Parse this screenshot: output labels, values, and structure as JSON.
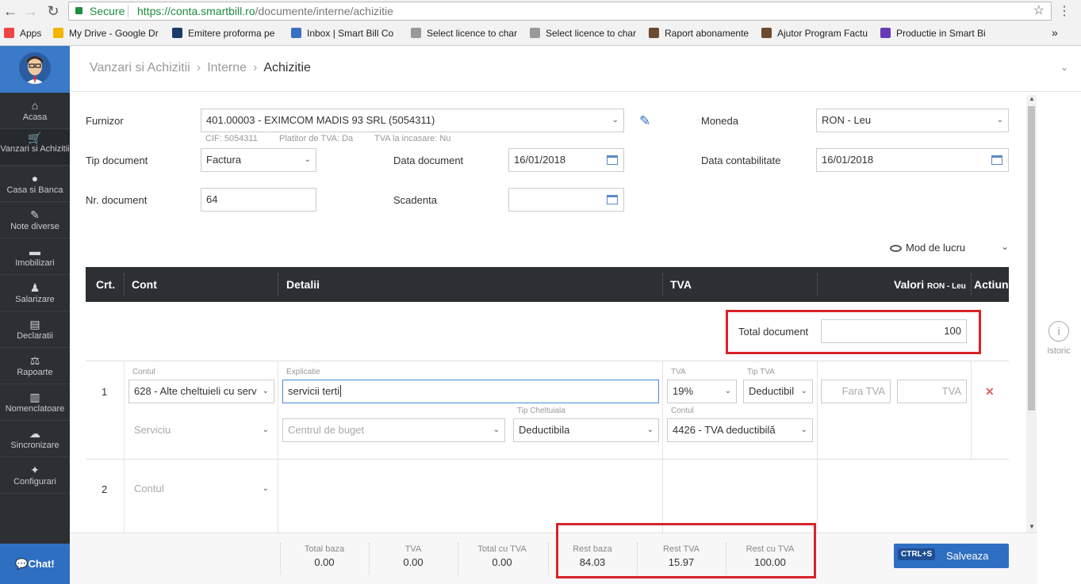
{
  "browser": {
    "secure_label": "Secure",
    "url_host": "https://conta.smartbill.ro",
    "url_path": "/documente/interne/achizitie",
    "bookmarks": [
      {
        "label": "Apps",
        "icon": "apps-grid-icon",
        "color": "#e44"
      },
      {
        "label": "My Drive - Google Dr",
        "icon": "drive-icon",
        "color": "#f4b400"
      },
      {
        "label": "Emitere proforma pe",
        "icon": "x-tool-icon",
        "color": "#1a3a6b"
      },
      {
        "label": "Inbox | Smart Bill Co",
        "icon": "inbox-icon",
        "color": "#3a6fc4"
      },
      {
        "label": "Select licence to char",
        "icon": "page-icon",
        "color": "#999"
      },
      {
        "label": "Select licence to char",
        "icon": "page-icon",
        "color": "#999"
      },
      {
        "label": "Raport abonamente",
        "icon": "person-icon",
        "color": "#6b4a2e"
      },
      {
        "label": "Ajutor Program Factu",
        "icon": "person-icon",
        "color": "#6b4a2e"
      },
      {
        "label": "Productie in Smart Bi",
        "icon": "form-icon",
        "color": "#673ab7"
      }
    ],
    "more": "»"
  },
  "sidebar": {
    "items": [
      {
        "label": "Acasa",
        "icon": "home-icon",
        "glyph": "⌂"
      },
      {
        "label": "Vanzari si Achizitii",
        "icon": "cart-icon",
        "glyph": "🛒"
      },
      {
        "label": "Casa si Banca",
        "icon": "coins-icon",
        "glyph": "●"
      },
      {
        "label": "Note diverse",
        "icon": "edit-note-icon",
        "glyph": "✎"
      },
      {
        "label": "Imobilizari",
        "icon": "car-icon",
        "glyph": "▬"
      },
      {
        "label": "Salarizare",
        "icon": "users-icon",
        "glyph": "♟"
      },
      {
        "label": "Declaratii",
        "icon": "document-icon",
        "glyph": "▤"
      },
      {
        "label": "Rapoarte",
        "icon": "scale-icon",
        "glyph": "⚖"
      },
      {
        "label": "Nomenclatoare",
        "icon": "book-icon",
        "glyph": "▥"
      },
      {
        "label": "Sincronizare",
        "icon": "cloud-sync-icon",
        "glyph": "☁"
      },
      {
        "label": "Configurari",
        "icon": "wrench-icon",
        "glyph": "✦"
      }
    ],
    "chat": "Chat!"
  },
  "header": {
    "crumbs": [
      "Vanzari si Achizitii",
      "Interne",
      "Achizitie"
    ]
  },
  "form": {
    "furnizor_label": "Furnizor",
    "furnizor_value": "401.00003 - EXIMCOM MADIS 93 SRL (5054311)",
    "cif": "CIF: 5054311",
    "platitor": "Platitor de TVA: Da",
    "tva_incasare": "TVA la incasare: Nu",
    "moneda_label": "Moneda",
    "moneda_value": "RON - Leu",
    "tip_doc_label": "Tip document",
    "tip_doc_value": "Factura",
    "data_doc_label": "Data document",
    "data_doc_value": "16/01/2018",
    "data_cont_label": "Data contabilitate",
    "data_cont_value": "16/01/2018",
    "nr_doc_label": "Nr. document",
    "nr_doc_value": "64",
    "scadenta_label": "Scadenta",
    "scadenta_value": "",
    "mod_lucru": "Mod de lucru"
  },
  "table": {
    "headers": {
      "crt": "Crt.",
      "cont": "Cont",
      "detalii": "Detalii",
      "tva": "TVA",
      "valori": "Valori",
      "valori_sub": "RON - Leu",
      "actiuni": "Actiuni"
    },
    "total_document_label": "Total document",
    "total_document_value": "100",
    "rows": [
      {
        "nr": "1",
        "contul_label": "Contul",
        "contul_value": "628 - Alte cheltuieli cu serv",
        "explicatie_label": "Explicatie",
        "explicatie_value": "servicii terti",
        "tva_label": "TVA",
        "tva_value": "19%",
        "tip_tva_label": "Tip TVA",
        "tip_tva_value": "Deductibil",
        "fara_tva_ph": "Fara TVA",
        "tva_ph": "TVA",
        "serviciu_ph": "Serviciu",
        "centru_ph": "Centrul de buget",
        "tip_chelt_label": "Tip Cheltuiala",
        "tip_chelt_value": "Deductibila",
        "contul2_label": "Contul",
        "contul2_value": "4426 - TVA deductibilă"
      },
      {
        "nr": "2",
        "contul_ph": "Contul"
      }
    ]
  },
  "totals": [
    {
      "label": "Total baza",
      "value": "0.00"
    },
    {
      "label": "TVA",
      "value": "0.00"
    },
    {
      "label": "Total cu TVA",
      "value": "0.00"
    },
    {
      "label": "Rest baza",
      "value": "84.03"
    },
    {
      "label": "Rest TVA",
      "value": "15.97"
    },
    {
      "label": "Rest cu TVA",
      "value": "100.00"
    }
  ],
  "save": {
    "shortcut": "CTRL+S",
    "label": "Salveaza"
  },
  "istoric": "Istoric"
}
